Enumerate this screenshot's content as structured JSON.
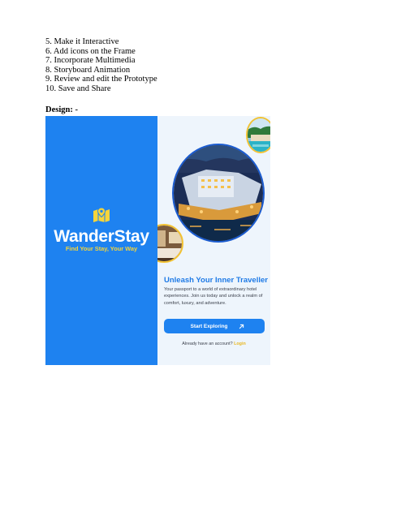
{
  "document": {
    "steps": [
      "5. Make it Interactive",
      "6. Add icons on the Frame",
      "7. Incorporate Multimedia",
      "8. Storyboard Animation",
      "9. Review and edit the Prototype",
      "10. Save and Share"
    ],
    "design_heading": "Design: -"
  },
  "splash": {
    "background_color": "#1e82f0",
    "logo_icon": "map-pin-icon",
    "brand_name": "WanderStay",
    "tagline": "Find Your Stay, Your Way",
    "tagline_color": "#f6d53a"
  },
  "onboarding": {
    "title": "Unleash Your Inner Traveller",
    "description": "Your passport to a world of extraordinary hotel experiences. Join us today and unlock a realm of comfort, luxury, and adventure.",
    "cta_label": "Start Exploring",
    "cta_icon": "arrow-up-right-icon",
    "account_prompt": "Already have an account?",
    "login_label": "Login",
    "accent_color": "#1e82f0",
    "login_color": "#e9b824"
  }
}
